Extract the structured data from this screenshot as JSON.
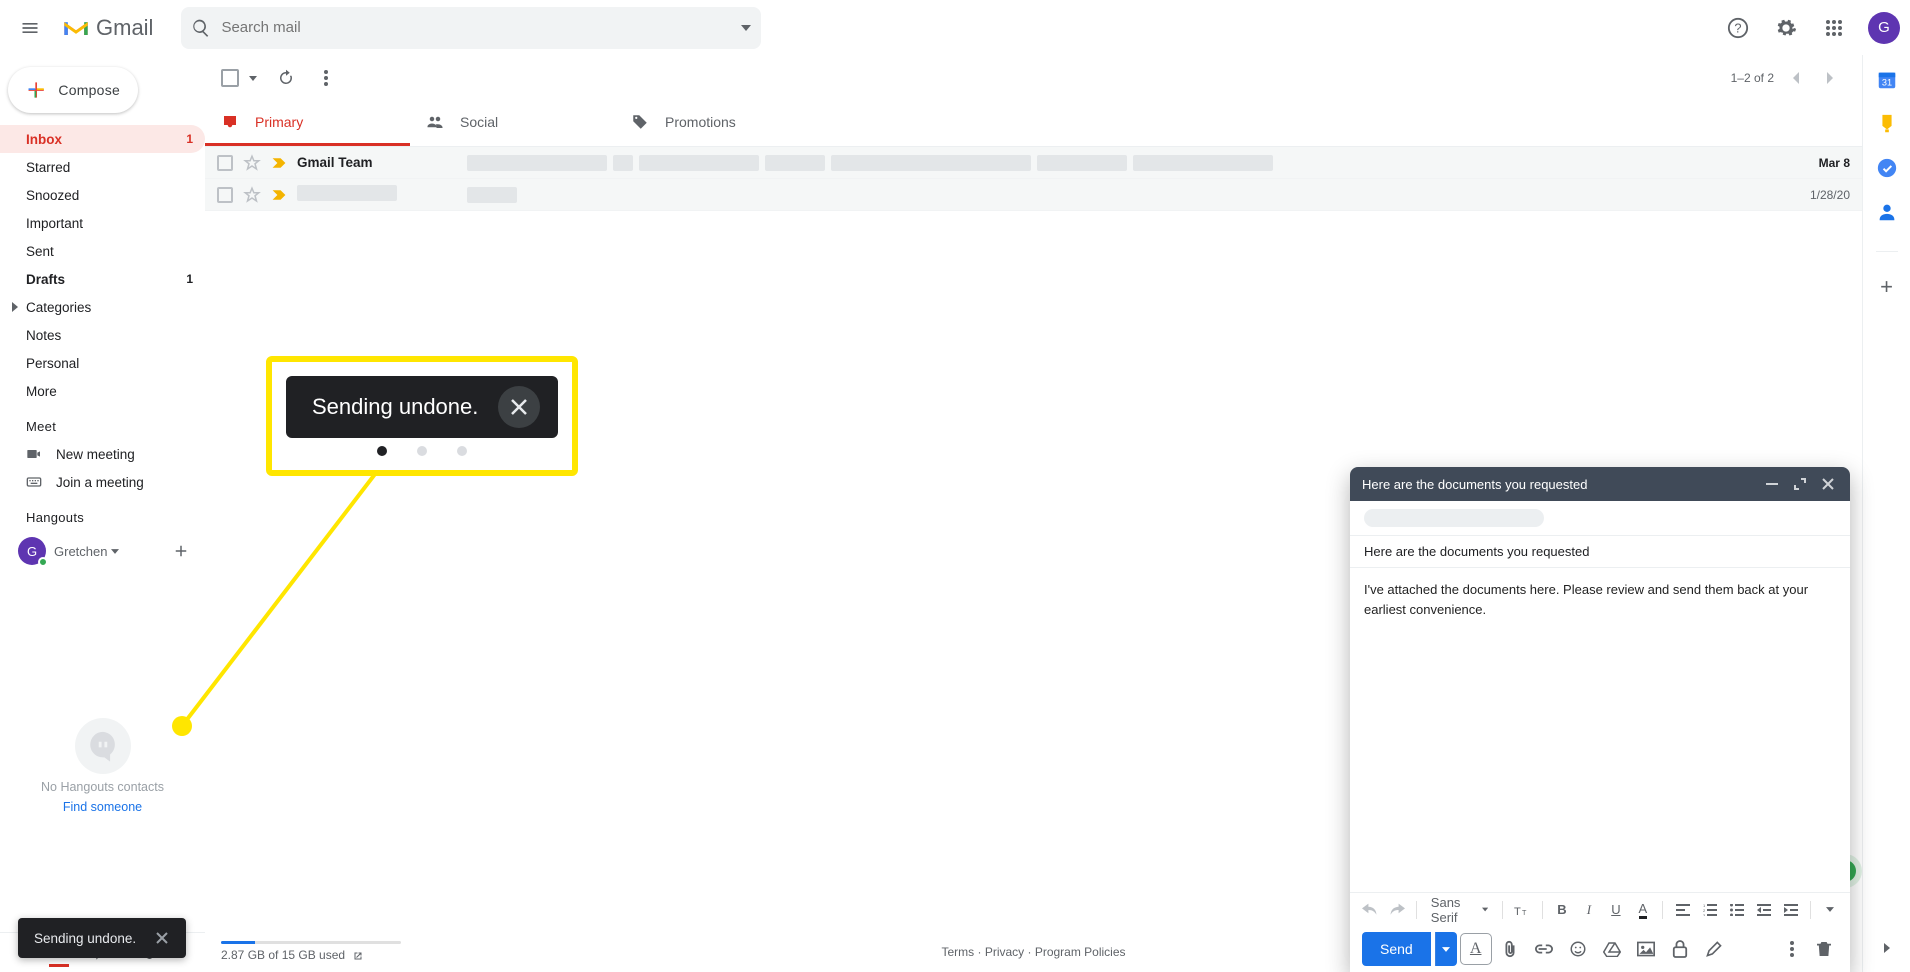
{
  "brand": {
    "name": "Gmail"
  },
  "search": {
    "placeholder": "Search mail"
  },
  "compose": {
    "label": "Compose"
  },
  "nav": {
    "inbox": {
      "label": "Inbox",
      "count": "1"
    },
    "starred": {
      "label": "Starred"
    },
    "snoozed": {
      "label": "Snoozed"
    },
    "important": {
      "label": "Important"
    },
    "sent": {
      "label": "Sent"
    },
    "drafts": {
      "label": "Drafts",
      "count": "1"
    },
    "categories": {
      "label": "Categories"
    },
    "notes": {
      "label": "Notes"
    },
    "personal": {
      "label": "Personal"
    },
    "more": {
      "label": "More"
    }
  },
  "meet": {
    "title": "Meet",
    "new": "New meeting",
    "join": "Join a meeting"
  },
  "hangouts": {
    "title": "Hangouts",
    "name": "Gretchen",
    "empty_line1": "No Hangouts contacts",
    "find": "Find someone"
  },
  "avatar_initial": "G",
  "toolbar": {
    "page_info": "1–2 of 2"
  },
  "tabs": {
    "primary": "Primary",
    "social": "Social",
    "promotions": "Promotions"
  },
  "rows": [
    {
      "sender": "Gmail Team",
      "subject_blur": true,
      "date": "Mar 8"
    },
    {
      "sender_blur": true,
      "subject_blur": true,
      "date": "1/28/20"
    }
  ],
  "footer": {
    "storage_text": "2.87 GB of 15 GB used",
    "terms": "Terms",
    "privacy": "Privacy",
    "program": "Program Policies"
  },
  "compose_window": {
    "title": "Here are the documents you requested",
    "subject": "Here are the documents you requested",
    "body": "I've attached the documents here. Please review and send them back at your earliest convenience.",
    "font": "Sans Serif",
    "send": "Send"
  },
  "toast": {
    "text": "Sending undone."
  },
  "callout": {
    "text": "Sending undone."
  }
}
